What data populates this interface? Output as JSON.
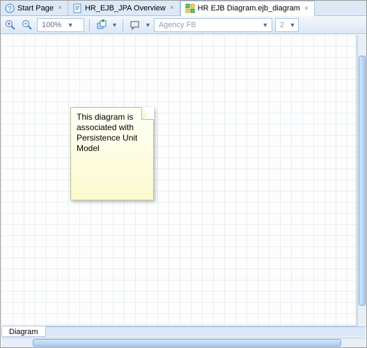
{
  "tabs": [
    {
      "label": "Start Page",
      "icon": "help-icon",
      "active": false
    },
    {
      "label": "HR_EJB_JPA Overview",
      "icon": "page-icon",
      "active": false
    },
    {
      "label": "HR EJB Diagram.ejb_diagram",
      "icon": "diagram-icon",
      "active": true
    }
  ],
  "toolbar": {
    "zoom_value": "100%",
    "font_dropdown": "Agency FB",
    "fontsize_dropdown": "2"
  },
  "note": {
    "text": "This diagram is associated with Persistence Unit Model"
  },
  "bottom": {
    "tab_label": "Diagram"
  }
}
